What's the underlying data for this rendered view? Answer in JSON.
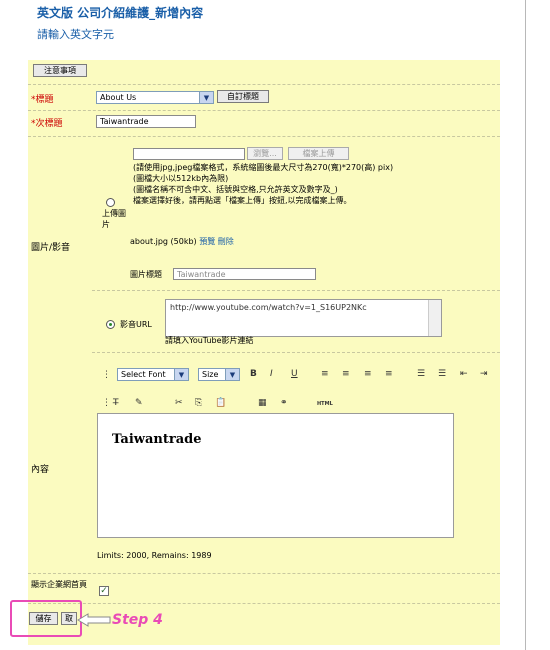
{
  "header": {
    "title": "英文版 公司介紹維護_新增內容",
    "subtitle": "請輸入英文字元"
  },
  "notice_button": "注意事項",
  "fields": {
    "title_label": "*標題",
    "title_select_value": "About Us",
    "custom_title_button": "自訂標題",
    "subtitle_label": "*次標題",
    "subtitle_value": "Taiwantrade",
    "media_label": "圖片/影音",
    "browse_button": "瀏覽...",
    "upload_button": "檔案上傳",
    "upload_notes": [
      "(請使用jpg,jpeg檔案格式，系統縮圖後最大尺寸為270(寬)*270(高) pix)",
      "(圖檔大小以512kb內為限)",
      "(圖檔名稱不可含中文、括號與空格,只允許英文及數字及_)",
      "檔案選擇好後，請再點選「檔案上傳」按鈕,以完成檔案上傳。"
    ],
    "upload_image_option": "上傳圖片",
    "file_info": "about.jpg (50kb)",
    "preview_link": "預覽",
    "delete_link": "刪除",
    "image_caption_label": "圖片標題",
    "image_caption_value": "Taiwantrade",
    "video_option": "影音URL",
    "video_url": "http://www.youtube.com/watch?v=1_S16UP2NKc",
    "video_hint": "請填入YouTube影片連結",
    "content_label": "內容",
    "font_select": "Select Font",
    "size_select": "Size",
    "html_button": "HTML",
    "editor_text": "Taiwantrade",
    "limits": "Limits: 2000, Remains: 1989",
    "show_homepage_label": "顯示企業網首頁"
  },
  "footer": {
    "save_button": "儲存",
    "cancel_button": "取",
    "step_label": "Step 4",
    "highlight_color": "#e94bb6"
  }
}
